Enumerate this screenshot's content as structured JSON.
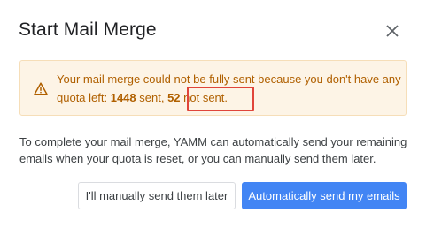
{
  "dialog": {
    "title": "Start Mail Merge",
    "close_icon": "close-icon"
  },
  "warning": {
    "icon": "warning-triangle-icon",
    "line_prefix": "Your mail merge could not be fully sent because you don't have any quota left: ",
    "sent_count": "1448",
    "sent_suffix": " sent, ",
    "not_sent_count": "52",
    "not_sent_suffix": " not sent.",
    "text_color": "#b06000",
    "background_color": "#fdf4e6"
  },
  "body": {
    "text": "To complete your mail merge, YAMM can automatically send your remaining emails when your quota is reset, or you can manually send them later."
  },
  "actions": {
    "manual_label": "I'll manually send them later",
    "auto_label": "Automatically send my emails",
    "primary_color": "#4285f4"
  },
  "annotation": {
    "highlight_color": "#e0453a"
  }
}
